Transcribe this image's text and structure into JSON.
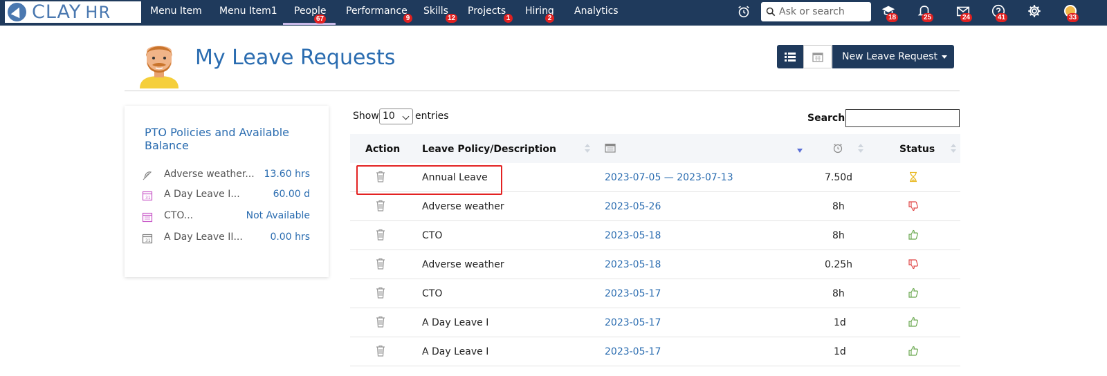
{
  "app": {
    "logo_main": "CLAY",
    "logo_sub": "HR"
  },
  "nav": {
    "items": [
      {
        "label": "Menu Item",
        "badge": ""
      },
      {
        "label": "Menu Item1",
        "badge": ""
      },
      {
        "label": "People",
        "badge": "67"
      },
      {
        "label": "Performance",
        "badge": "9"
      },
      {
        "label": "Skills",
        "badge": "12"
      },
      {
        "label": "Projects",
        "badge": "1"
      },
      {
        "label": "Hiring",
        "badge": "2"
      },
      {
        "label": "Analytics",
        "badge": ""
      }
    ],
    "search_placeholder": "Ask or search",
    "icon_badges": {
      "learning": "18",
      "notifications": "25",
      "messages": "24",
      "help": "41",
      "profile": "33"
    }
  },
  "page": {
    "title": "My Leave Requests",
    "new_button": "New Leave Request"
  },
  "pto": {
    "title": "PTO Policies and Available Balance",
    "items": [
      {
        "name": "Adverse weather...",
        "value": "13.60 hrs",
        "icon": "feather-icon"
      },
      {
        "name": "A Day Leave I...",
        "value": "60.00 d",
        "icon": "calendar-icon"
      },
      {
        "name": "CTO...",
        "value": "Not Available",
        "icon": "calendar-icon"
      },
      {
        "name": "A Day Leave II...",
        "value": "0.00 hrs",
        "icon": "calendar-icon"
      }
    ]
  },
  "table_controls": {
    "show": "Show",
    "page_size": "10",
    "entries": "entries",
    "search": "Search:"
  },
  "table": {
    "headers": {
      "action": "Action",
      "policy": "Leave Policy/Description",
      "status": "Status"
    },
    "rows": [
      {
        "policy": "Annual Leave",
        "date": "2023-07-05 — 2023-07-13",
        "duration": "7.50d",
        "status": "pending"
      },
      {
        "policy": "Adverse weather",
        "date": "2023-05-26",
        "duration": "8h",
        "status": "rejected"
      },
      {
        "policy": "CTO",
        "date": "2023-05-18",
        "duration": "8h",
        "status": "approved"
      },
      {
        "policy": "Adverse weather",
        "date": "2023-05-18",
        "duration": "0.25h",
        "status": "rejected"
      },
      {
        "policy": "CTO",
        "date": "2023-05-17",
        "duration": "8h",
        "status": "approved"
      },
      {
        "policy": "A Day Leave I",
        "date": "2023-05-17",
        "duration": "1d",
        "status": "approved"
      },
      {
        "policy": "A Day Leave I",
        "date": "2023-05-17",
        "duration": "1d",
        "status": "approved"
      }
    ]
  },
  "colors": {
    "nav_bg": "#1f3a5c",
    "accent": "#2a6cb0",
    "badge": "#e02020",
    "highlight": "#e32222"
  }
}
